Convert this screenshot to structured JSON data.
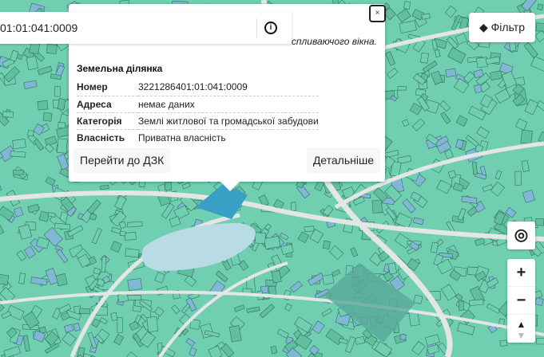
{
  "search": {
    "value": "01:01:041:0009",
    "info_icon": "info-icon"
  },
  "popup": {
    "hint": "спливаючого вікна.",
    "title": "Земельна ділянка",
    "rows": [
      {
        "label": "Номер",
        "value": "3221286401:01:041:0009"
      },
      {
        "label": "Адреса",
        "value": "немає даних"
      },
      {
        "label": "Категорія",
        "value": "Землі житлової та громадської забудови"
      },
      {
        "label": "Власність",
        "value": "Приватна власність"
      }
    ],
    "go_dzk": "Перейти до ДЗК",
    "details": "Детальніше",
    "close": "×"
  },
  "controls": {
    "filter": "Фільтр",
    "zoom_in": "+",
    "zoom_out": "−"
  },
  "colors": {
    "parcel": "#6fcfb0",
    "parcel_alt": "#7fb7d4",
    "road": "#e4e6e6",
    "water": "#b9dbe6"
  }
}
